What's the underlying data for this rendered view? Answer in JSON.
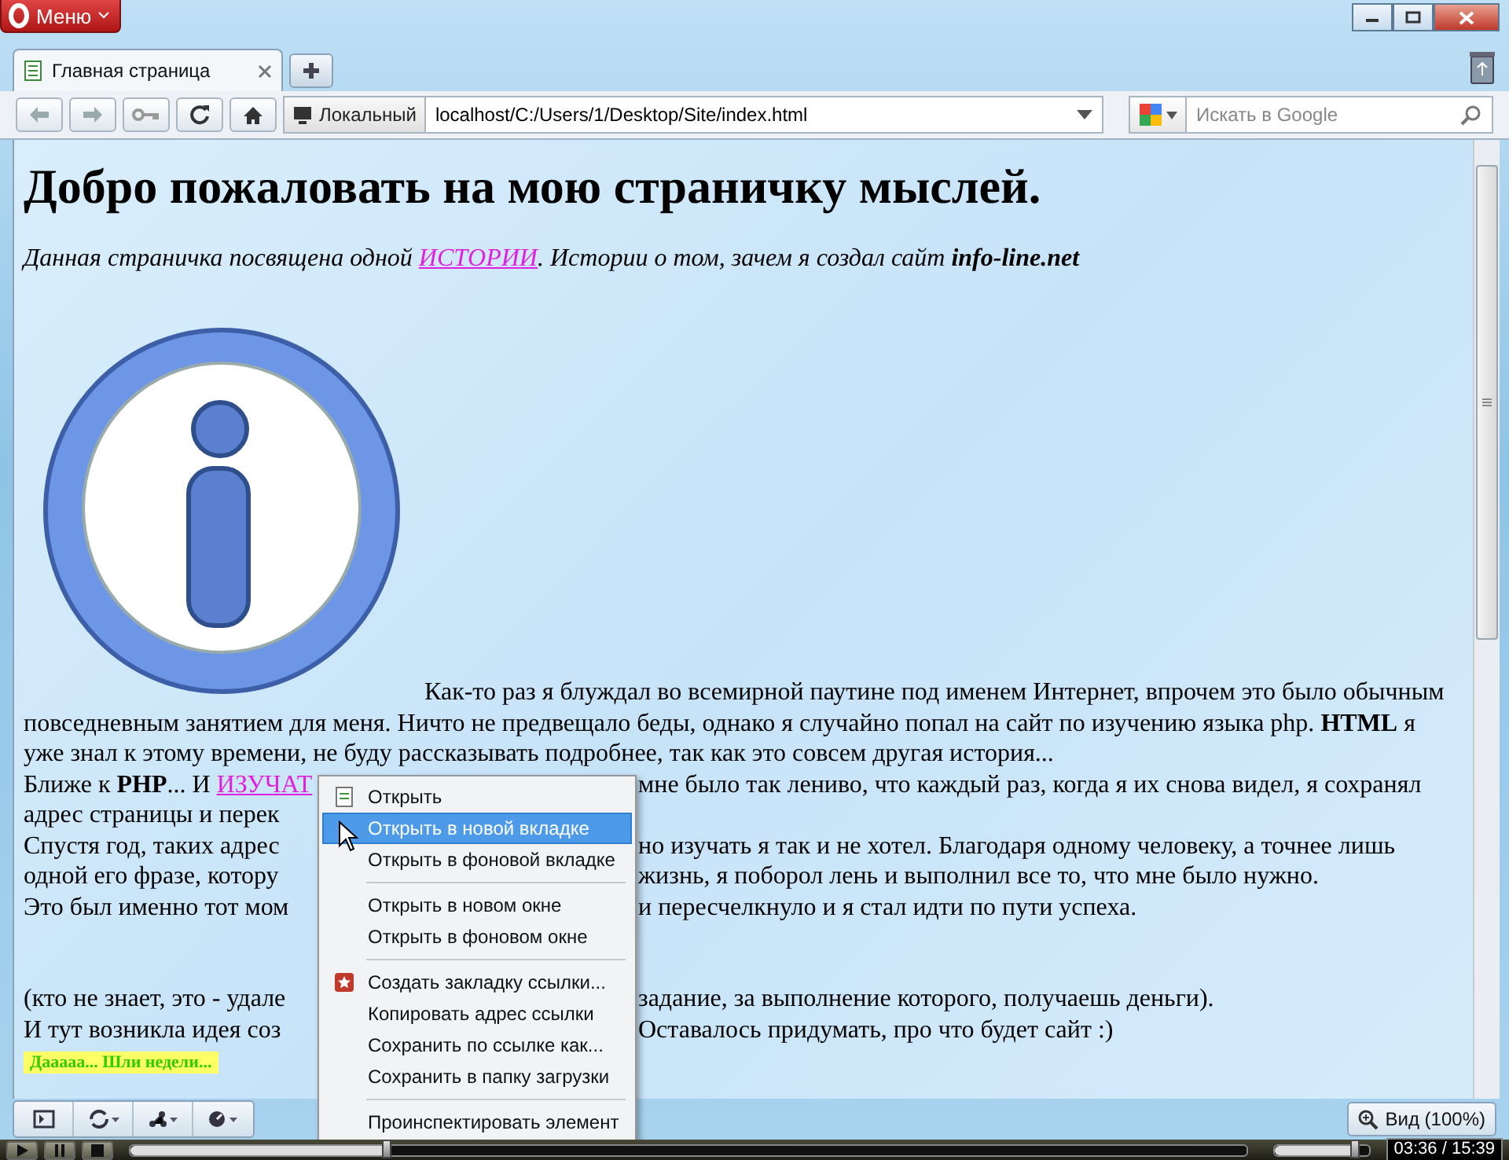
{
  "menu_button": {
    "label": "Меню"
  },
  "tabs": [
    {
      "label": "Главная страница",
      "selected": true
    }
  ],
  "address_bar": {
    "badge": "Локальный",
    "value": "localhost/C:/Users/1/Desktop/Site/index.html"
  },
  "search": {
    "placeholder": "Искать в Google"
  },
  "page": {
    "heading": "Добро пожаловать на мою страничку мыслей.",
    "intro": {
      "before": "Данная страничка посвящена одной ",
      "link": "ИСТОРИИ",
      "after": ". Истории о том, зачем я создал сайт **info-line.net**"
    },
    "first_line": "Как-то раз я блуждал во всемирной паутине под именем Интернет, впрочем это было обычным",
    "paragraphs": [
      [
        {
          "left": "повседневным занятием для меня. Ничто не предвещало беды, однако я случайно попал на сайт по изучению языка php. **HTML** я"
        },
        {
          "left": "уже знал к этому времени, не буду рассказывать подробнее, так как это совсем другая история..."
        },
        {
          "left": "Ближе к **PHP**... И ",
          "link": "ИЗУЧАТ",
          "right": "мне было так лениво, что каждый раз, когда я их снова видел, я сохранял"
        },
        {
          "left": "адрес страницы и перек"
        },
        {
          "left": "Спустя год, таких адрес",
          "right": "но изучать я так и не хотел. Благодаря одному человеку, а точнее лишь"
        },
        {
          "left": "одной его фразе, котору",
          "right": "жизнь, я поборол лень и выполнил все то, что мне было нужно."
        },
        {
          "left": "Это был именно тот мом",
          "right": "и пересчелкнуло и я стал идти по пути успеха."
        }
      ],
      [
        {
          "left": "(кто не знает, это - удале",
          "right": "задание, за выполнение которого, получаешь деньги)."
        },
        {
          "left": "И тут возникла идея соз",
          "right": "Оставалось придумать, про что будет сайт :)"
        }
      ]
    ],
    "note": "Дааааа... Шли недели..."
  },
  "context_menu": {
    "groups": [
      [
        {
          "label": "Открыть",
          "kind": "page",
          "selected": false
        },
        {
          "label": "Открыть в новой вкладке",
          "kind": "plain",
          "selected": true
        },
        {
          "label": "Открыть в фоновой вкладке",
          "kind": "plain",
          "selected": false
        }
      ],
      [
        {
          "label": "Открыть в новом окне",
          "kind": "plain",
          "selected": false
        },
        {
          "label": "Открыть в фоновом окне",
          "kind": "plain",
          "selected": false
        }
      ],
      [
        {
          "label": "Создать закладку ссылки...",
          "kind": "bookmark",
          "selected": false
        },
        {
          "label": "Копировать адрес ссылки",
          "kind": "plain",
          "selected": false
        },
        {
          "label": "Сохранить по ссылке как...",
          "kind": "plain",
          "selected": false
        },
        {
          "label": "Сохранить в папку загрузки",
          "kind": "plain",
          "selected": false
        }
      ],
      [
        {
          "label": "Проинспектировать элемент",
          "kind": "plain",
          "selected": false
        }
      ]
    ]
  },
  "status_bar": {
    "zoom": "Вид (100%)"
  },
  "player": {
    "progress": {
      "level": 0.23
    },
    "volume": {
      "level": 0.85
    },
    "time": "03:36 / 15:39"
  }
}
